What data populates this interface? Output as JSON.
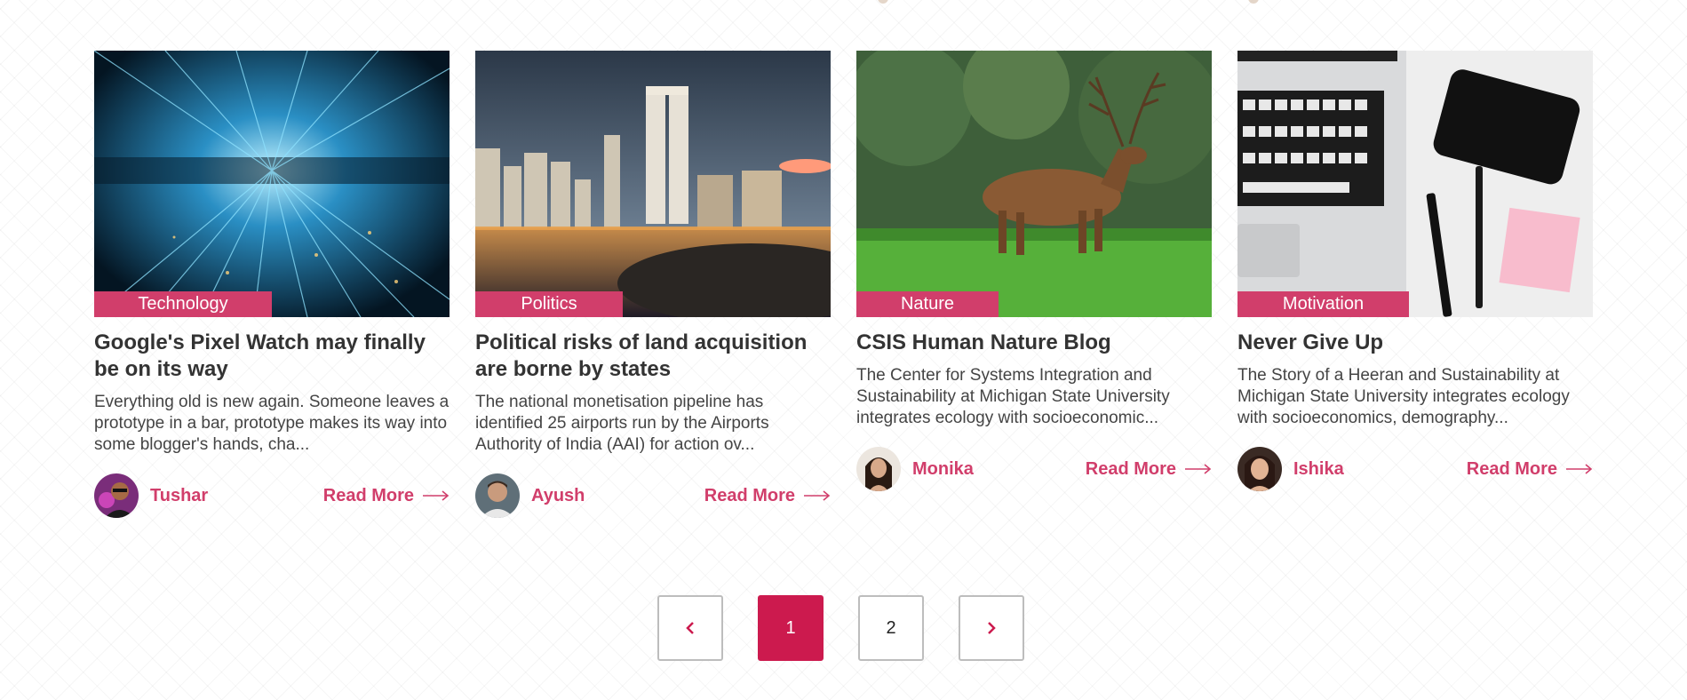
{
  "posts": [
    {
      "category": "Technology",
      "title": "Google's Pixel Watch may finally be on its way",
      "excerpt": "Everything old is new again. Someone leaves a prototype in a bar, prototype makes its way into some blogger's hands, cha...",
      "author": "Tushar",
      "read_more": "Read More"
    },
    {
      "category": "Politics",
      "title": "Political risks of land acquisition are borne by states",
      "excerpt": "The national monetisation pipeline has identified 25 airports run by the Airports Authority of India (AAI) for action ov...",
      "author": "Ayush",
      "read_more": "Read More"
    },
    {
      "category": "Nature",
      "title": "CSIS Human Nature Blog",
      "excerpt": "The Center for Systems Integration and Sustainability at Michigan State University integrates ecology with socioeconomic...",
      "author": "Monika",
      "read_more": "Read More"
    },
    {
      "category": "Motivation",
      "title": "Never Give Up",
      "excerpt": "The Story of a Heeran and Sustainability at Michigan State University integrates ecology with socioeconomics, demography...",
      "author": "Ishika",
      "read_more": "Read More"
    }
  ],
  "pagination": {
    "prev_icon": "chevron-left-icon",
    "pages": [
      "1",
      "2"
    ],
    "current": "1",
    "next_icon": "chevron-right-icon"
  },
  "colors": {
    "accent": "#d13e6b",
    "active_page": "#cc1a4e"
  }
}
